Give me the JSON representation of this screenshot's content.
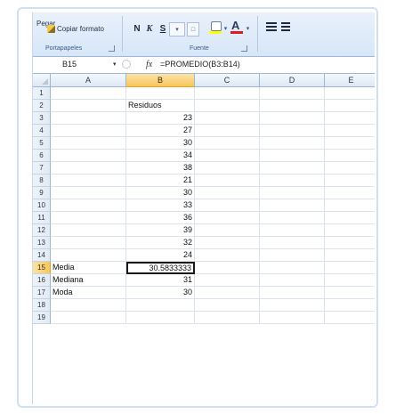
{
  "ribbon": {
    "paste_label": "Pegar",
    "copy_format_label": "Copiar formato",
    "clipboard_group_label": "Portapapeles",
    "font_group_label": "Fuente",
    "bold_label": "N",
    "italic_label": "K",
    "underline_label": "S",
    "font_color_letter": "A",
    "fill_color": "#ffff00",
    "font_color": "#e01b1b"
  },
  "formula_bar": {
    "name_box": "B15",
    "fx_label": "fx",
    "formula": "=PROMEDIO(B3:B14)"
  },
  "sheet": {
    "columns": [
      "A",
      "B",
      "C",
      "D",
      "E"
    ],
    "selected_column": "B",
    "selected_row": "15",
    "rows": [
      {
        "num": "1",
        "a": "",
        "b": ""
      },
      {
        "num": "2",
        "a": "",
        "b": "Residuos"
      },
      {
        "num": "3",
        "a": "",
        "b": "23"
      },
      {
        "num": "4",
        "a": "",
        "b": "27"
      },
      {
        "num": "5",
        "a": "",
        "b": "30"
      },
      {
        "num": "6",
        "a": "",
        "b": "34"
      },
      {
        "num": "7",
        "a": "",
        "b": "38"
      },
      {
        "num": "8",
        "a": "",
        "b": "21"
      },
      {
        "num": "9",
        "a": "",
        "b": "30"
      },
      {
        "num": "10",
        "a": "",
        "b": "33"
      },
      {
        "num": "11",
        "a": "",
        "b": "36"
      },
      {
        "num": "12",
        "a": "",
        "b": "39"
      },
      {
        "num": "13",
        "a": "",
        "b": "32"
      },
      {
        "num": "14",
        "a": "",
        "b": "24"
      },
      {
        "num": "15",
        "a": "Media",
        "b": "30.5833333"
      },
      {
        "num": "16",
        "a": "Mediana",
        "b": "31"
      },
      {
        "num": "17",
        "a": "Moda",
        "b": "30"
      },
      {
        "num": "18",
        "a": "",
        "b": ""
      },
      {
        "num": "19",
        "a": "",
        "b": ""
      }
    ]
  },
  "colors": {
    "header_selected": "#f7c65d",
    "ribbon_bg": "#d7e6f7",
    "grid_line": "#dbe2ea"
  }
}
